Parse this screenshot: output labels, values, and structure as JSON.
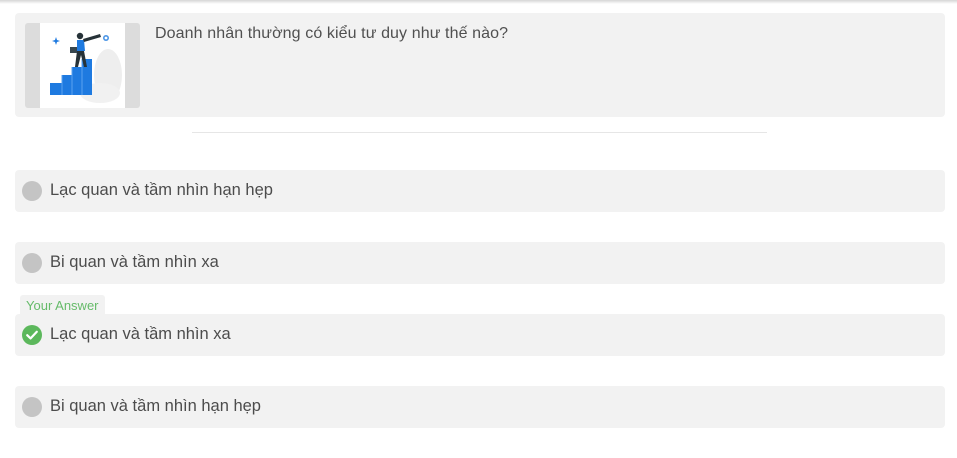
{
  "question": {
    "text": "Doanh nhân thường có kiểu tư duy như thế nào?",
    "image_icon": "businessman-telescope-on-stairs-illustration"
  },
  "your_answer_label": "Your Answer",
  "options": [
    {
      "label": "Lạc quan và tầm nhìn hạn hẹp",
      "selected": false,
      "icon": "radio-empty-icon"
    },
    {
      "label": "Bi quan và tầm nhìn xa",
      "selected": false,
      "icon": "radio-empty-icon"
    },
    {
      "label": "Lạc quan và tầm nhìn xa",
      "selected": true,
      "icon": "check-circle-icon"
    },
    {
      "label": "Bi quan và tầm nhìn hạn hẹp",
      "selected": false,
      "icon": "radio-empty-icon"
    }
  ],
  "colors": {
    "card_bg": "#f2f2f2",
    "radio_gray": "#c4c4c4",
    "correct_green": "#5cb85c",
    "your_answer_text": "#66bb6a",
    "accent_blue": "#1e7ae0"
  }
}
